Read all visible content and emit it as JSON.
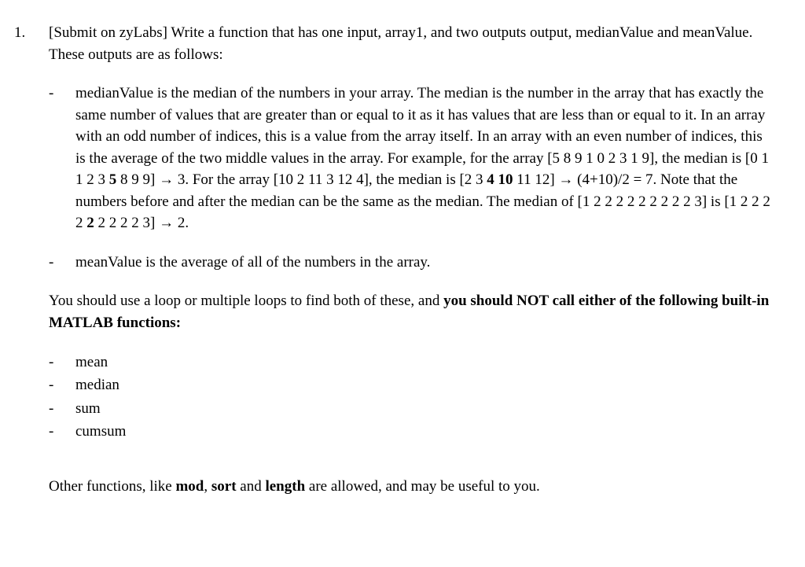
{
  "question": {
    "number": "1.",
    "intro": "[Submit on zyLabs] Write a function that has one input, array1, and two outputs output, medianValue and meanValue. These outputs are as follows:",
    "bullets": {
      "median_parts": {
        "p1": "medianValue is the median of the numbers in your array. The median is the number in the array that has exactly the same number of values that are greater than or equal to it as it has values that are less than or equal to it. In an array with an odd number of indices, this is a value from the array itself. In an array with an even number of indices, this is the average of the two middle values in the array. For example, for the array [5 8 9 1 0 2 3 1 9], the median is [0 1 1 2 3 ",
        "b1": "5",
        "p2": " 8 9 9] → 3. For the array [10 2 11 3 12 4], the median is [2 3 ",
        "b2": "4 10",
        "p3": " 11 12] → (4+10)/2 = 7. Note that the numbers before and after the median can be the same as the median. The median of [1 2 2 2 2 2 2 2 2 2 3] is [1 2 2 2 2 ",
        "b3": "2",
        "p4": " 2 2 2 2 3] → 2."
      },
      "mean": "meanValue is the average of all of the numbers in the array."
    },
    "mid_para": {
      "p1": "You should use a loop or multiple loops to find both of these, and ",
      "b1": "you should NOT call either of the following built-in MATLAB functions:"
    },
    "forbidden": {
      "f1": "mean",
      "f2": "median",
      "f3": "sum",
      "f4": "cumsum"
    },
    "closing": {
      "p1": "Other functions, like ",
      "b1": "mod",
      "p2": ", ",
      "b2": "sort",
      "p3": " and ",
      "b3": "length",
      "p4": " are allowed, and may be useful to you."
    }
  }
}
